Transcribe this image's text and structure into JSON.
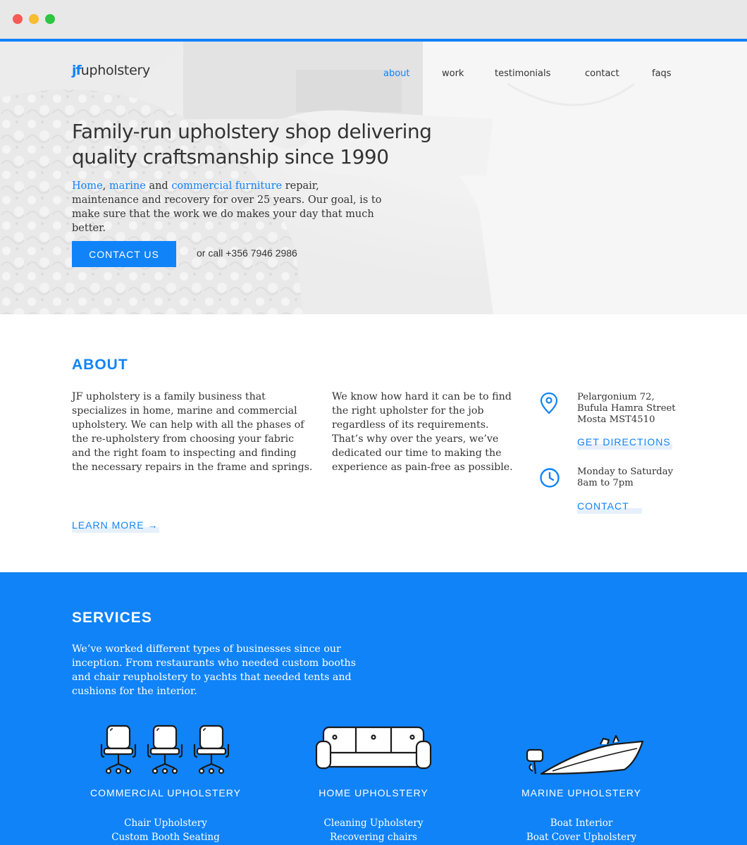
{
  "browser": {
    "controls": [
      "close",
      "minimize",
      "maximize"
    ]
  },
  "brand": {
    "mark": "jf",
    "name": "upholstery",
    "accent": "#1083f8"
  },
  "nav": [
    {
      "label": "about",
      "active": true
    },
    {
      "label": "work",
      "active": false
    },
    {
      "label": "testimonials",
      "active": false
    },
    {
      "label": "contact",
      "active": false
    },
    {
      "label": "faqs",
      "active": false
    }
  ],
  "hero": {
    "title_line1": "Family-run upholstery shop delivering",
    "title_line2": "quality craftsmanship since 1990",
    "text_link1": "Home",
    "text_sep": ", ",
    "text_link2": "marine",
    "text_and": " and ",
    "text_link3": "commercial furniture",
    "text_rest": " repair, maintenance and recovery for over 25 years. Our goal, is to make sure that the work we do makes your day that much better.",
    "cta_label": "CONTACT US",
    "call_text": "or call +356 7946 2986"
  },
  "about": {
    "title": "ABOUT",
    "p1": "JF upholstery is a family business that specializes in home, marine and commercial upholstery. We can help with all the phases of the re-upholstery from choosing your fabric and the right foam to inspecting and finding the necessary repairs in the frame and springs.",
    "p2": "We know how hard it can be to find the right upholster for the job regardless of its requirements. That’s why over the years, we’ve dedicated our time to making the experience as pain-free as possible.",
    "learn_more": "LEARN MORE →",
    "address": {
      "icon": "location-pin-icon",
      "line1": "Pelargonium 72,",
      "line2": "Bufula Hamra Street",
      "line3": "Mosta MST4510",
      "cta": "GET DIRECTIONS"
    },
    "hours": {
      "icon": "clock-icon",
      "line1": "Monday to Saturday",
      "line2": "8am to 7pm",
      "cta": "CONTACT"
    }
  },
  "services": {
    "title": "SERVICES",
    "text": "We’ve worked different types of businesses since our inception. From restaurants who needed custom booths and chair reupholstery to yachts that needed tents and cushions for the interior.",
    "items": [
      {
        "icon": "office-chairs-icon",
        "title": "COMMERCIAL UPHOLSTERY",
        "lines": [
          "Chair Upholstery",
          "Custom Booth Seating"
        ]
      },
      {
        "icon": "sofa-icon",
        "title": "HOME UPHOLSTERY",
        "lines": [
          "Cleaning Upholstery",
          "Recovering chairs"
        ]
      },
      {
        "icon": "boat-icon",
        "title": "MARINE UPHOLSTERY",
        "lines": [
          "Boat Interior",
          "Boat Cover Upholstery"
        ]
      }
    ]
  }
}
